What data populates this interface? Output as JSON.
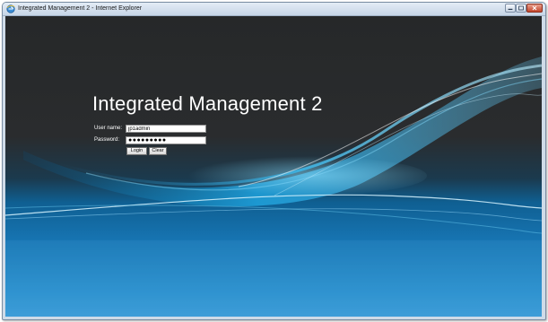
{
  "window": {
    "title": "Integrated Management 2 - Internet Explorer",
    "icon": "internet-explorer-icon",
    "controls": [
      "minimize-icon",
      "maximize-icon",
      "close-icon"
    ]
  },
  "page": {
    "heading": "Integrated Management 2"
  },
  "login_form": {
    "username_label": "User name:",
    "username_value": "jp1admin",
    "password_label": "Password:",
    "password_mask": "●●●●●●●●●",
    "login_button": "Login",
    "clear_button": "Clear"
  },
  "colors": {
    "background_top": "#262829",
    "background_bottom": "#2a8fcd",
    "accent_wave": "#2fb3e8",
    "title_text": "#ffffff"
  }
}
